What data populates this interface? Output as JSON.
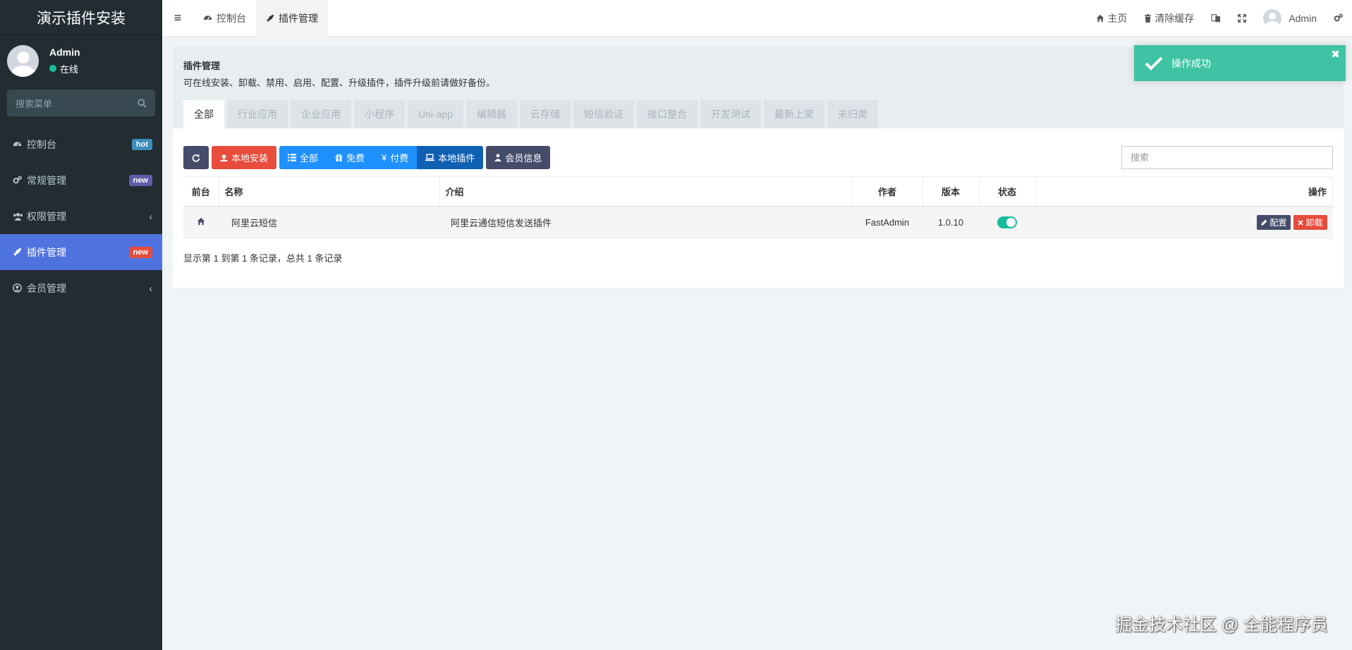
{
  "sidebar": {
    "brand": "演示插件安装",
    "user": {
      "name": "Admin",
      "status": "在线"
    },
    "search_placeholder": "搜索菜单",
    "items": [
      {
        "label": "控制台",
        "badge": "hot",
        "icon": "dashboard-icon"
      },
      {
        "label": "常规管理",
        "badge": "new",
        "icon": "cogs-icon"
      },
      {
        "label": "权限管理",
        "icon": "group-icon"
      },
      {
        "label": "插件管理",
        "badge": "new",
        "icon": "rocket-icon"
      },
      {
        "label": "会员管理",
        "icon": "user-circle-icon"
      }
    ]
  },
  "header": {
    "tabs": [
      {
        "label": "控制台"
      },
      {
        "label": "插件管理"
      }
    ],
    "home": "主页",
    "clear_cache": "清除缓存",
    "admin": "Admin"
  },
  "panel": {
    "title": "插件管理",
    "desc": "可在线安装、卸载、禁用、启用、配置、升级插件，插件升级前请做好备份。",
    "categories": [
      "全部",
      "行业应用",
      "企业应用",
      "小程序",
      "Uni-app",
      "编辑器",
      "云存储",
      "短信验证",
      "接口整合",
      "开发测试",
      "最新上架",
      "未归类"
    ]
  },
  "toolbar": {
    "local_install": "本地安装",
    "all": "全部",
    "free": "免费",
    "paid": "付费",
    "local_plugins": "本地插件",
    "member_info": "会员信息",
    "search_placeholder": "搜索"
  },
  "table": {
    "headers": {
      "front": "前台",
      "name": "名称",
      "intro": "介绍",
      "author": "作者",
      "version": "版本",
      "status": "状态",
      "ops": "操作"
    },
    "rows": [
      {
        "name": "阿里云短信",
        "intro": "阿里云通信短信发送插件",
        "author": "FastAdmin",
        "version": "1.0.10",
        "enabled": true,
        "config": "配置",
        "uninstall": "卸载"
      }
    ]
  },
  "pagination": "显示第 1 到第 1 条记录，总共 1 条记录",
  "toast": {
    "message": "操作成功"
  },
  "watermark": "掘金技术社区 @ 全能程序员",
  "colors": {
    "sidebar_bg": "#222d32",
    "accent": "#4e73df",
    "success": "#18bc9c",
    "danger": "#e74c3c"
  }
}
